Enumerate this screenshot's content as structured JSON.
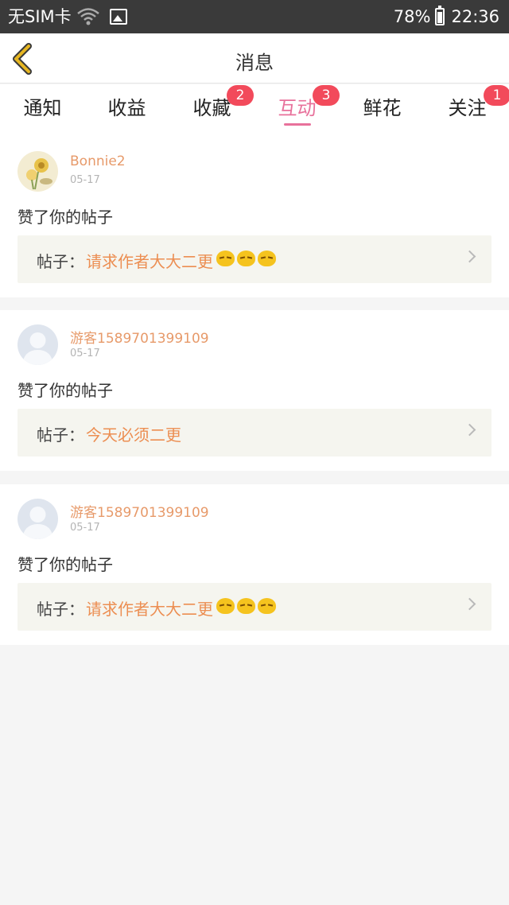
{
  "status_bar": {
    "carrier": "无SIM卡",
    "battery": "78%",
    "battery_level": 0.78,
    "time": "22:36"
  },
  "header": {
    "title": "消息"
  },
  "tabs": [
    {
      "label": "通知",
      "badge": ""
    },
    {
      "label": "收益",
      "badge": ""
    },
    {
      "label": "收藏",
      "badge": "2"
    },
    {
      "label": "互动",
      "badge": "3",
      "active": true
    },
    {
      "label": "鲜花",
      "badge": ""
    },
    {
      "label": "关注",
      "badge": "1"
    }
  ],
  "messages": [
    {
      "username": "Bonnie2",
      "date": "05-17",
      "action": "赞了你的帖子",
      "post_label": "帖子：",
      "post_title": "请求作者大大二更",
      "emoji_count": 3
    },
    {
      "username": "游客1589701399109",
      "date": "05-17",
      "action": "赞了你的帖子",
      "post_label": "帖子：",
      "post_title": "今天必须二更",
      "emoji_count": 0
    },
    {
      "username": "游客1589701399109",
      "date": "05-17",
      "action": "赞了你的帖子",
      "post_label": "帖子：",
      "post_title": "请求作者大大二更",
      "emoji_count": 3
    }
  ],
  "colors": {
    "accent": "#e8719b",
    "badge": "#f24a5b",
    "username": "#e79a6a",
    "post_title": "#ec8e52",
    "back_arrow": "#e6b622"
  },
  "icons": [
    "wifi-icon",
    "image-icon",
    "battery-icon",
    "back-arrow-icon",
    "chevron-right-icon",
    "emoji-icon"
  ]
}
